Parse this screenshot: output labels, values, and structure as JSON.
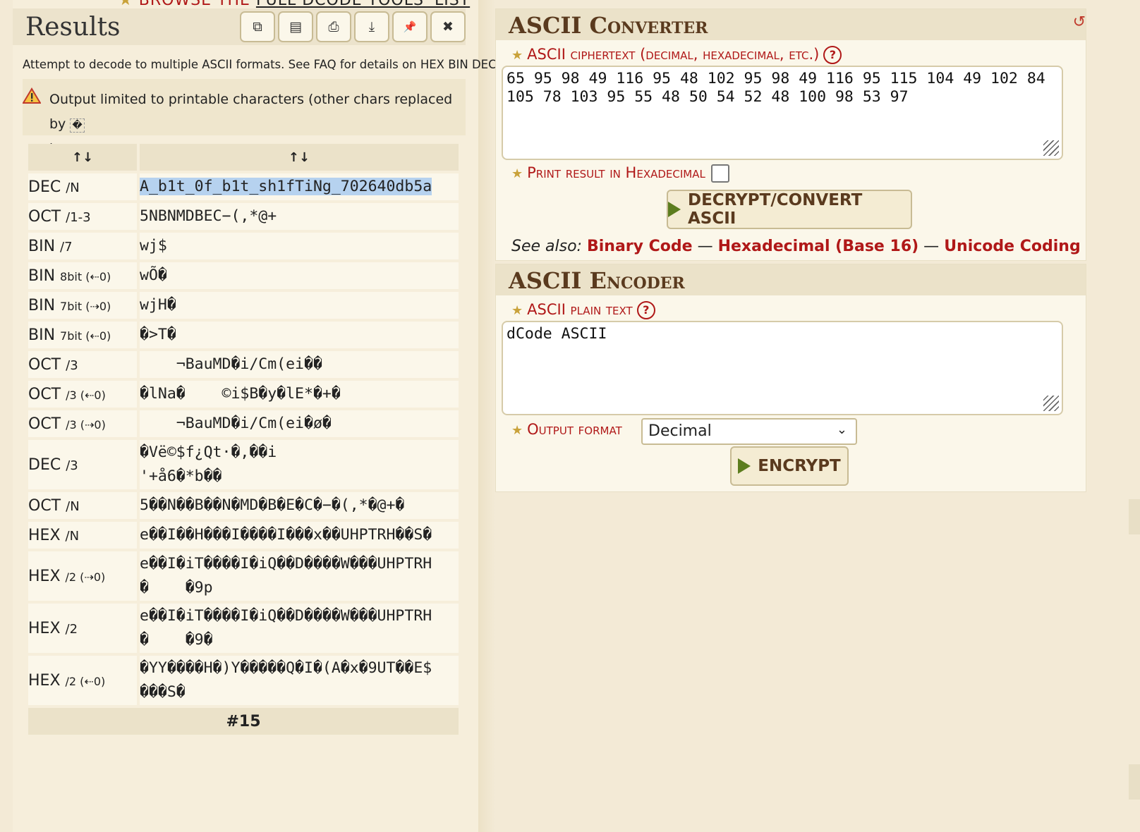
{
  "browse_link": {
    "star": "★",
    "prefix": "BROWSE THE",
    "link": "FULL DCODE TOOLS' LIST"
  },
  "results": {
    "title": "Results",
    "toolbar": [
      {
        "name": "copy-icon",
        "glyph": "⧉"
      },
      {
        "name": "save-icon",
        "glyph": "▤"
      },
      {
        "name": "print-icon",
        "glyph": "⎙"
      },
      {
        "name": "download-icon",
        "glyph": "⤓"
      },
      {
        "name": "pin-icon",
        "glyph": "📌"
      },
      {
        "name": "close-icon",
        "glyph": "✖"
      }
    ],
    "note": "Attempt to decode to multiple ASCII formats. See FAQ for details on HEX BIN DEC",
    "warning": "Output limited to printable characters (other chars replaced by",
    "warning_glyph": "�",
    "warning_close": ")",
    "sort_left": "↑↓",
    "sort_right": "↑↓",
    "rows": [
      {
        "label": "DEC",
        "sub": "/N",
        "value": "A_b1t_0f_b1t_sh1fTiNg_702640db5a"
      },
      {
        "label": "OCT",
        "sub": "/1-3",
        "value": "5NBNMDBEC−(,*@+"
      },
      {
        "label": "BIN",
        "sub": "/7",
        "value": "wj$"
      },
      {
        "label": "BIN",
        "sub": "8bit (⇠0)",
        "value": "wÕ�"
      },
      {
        "label": "BIN",
        "sub": "7bit (⇢0)",
        "value": "wjH�"
      },
      {
        "label": "BIN",
        "sub": "7bit (⇠0)",
        "value": "�>T�"
      },
      {
        "label": "OCT",
        "sub": "/3",
        "value": "    ¬BauMD�i/Cm(ei��"
      },
      {
        "label": "OCT",
        "sub": "/3 (⇠0)",
        "value": "�lNa�    ©i$B�y�lE*�+�"
      },
      {
        "label": "OCT",
        "sub": "/3 (⇢0)",
        "value": "    ¬BauMD�i/Cm(ei�ø�"
      },
      {
        "label": "DEC",
        "sub": "/3",
        "value": "�Vë©$f¿Qt·�,��i\n'+å6�*b��"
      },
      {
        "label": "OCT",
        "sub": "/N",
        "value": "5��N��B��N�MD�B�E�C�−�(,*�@+�"
      },
      {
        "label": "HEX",
        "sub": "/N",
        "value": "e��I��H���I����I���x��UHPTRH��S�"
      },
      {
        "label": "HEX",
        "sub": "/2 (⇢0)",
        "value": "e��I�iT����I�iQ��D����W���UHPTRH\n�    �9p"
      },
      {
        "label": "HEX",
        "sub": "/2",
        "value": "e��I�iT����I�iQ��D����W���UHPTRH\n�    �9�"
      },
      {
        "label": "HEX",
        "sub": "/2 (⇠0)",
        "value": "�YY����H�)Y�����Q�I�(A�x�9UT��E$\n���S�"
      }
    ],
    "footer": "#15"
  },
  "converter": {
    "title": "ASCII Converter",
    "refresh_glyph": "↺",
    "label": "ASCII ciphertext (decimal, hexadecimal, etc.)",
    "help": "?",
    "input_value": "65 95 98 49 116 95 48 102 95 98 49 116 95 115 104 49 102 84\n105 78 103 95 55 48 50 54 52 48 100 98 53 97",
    "hex_label": "Print result in Hexadecimal",
    "hex_checked": false,
    "button": "DECRYPT/CONVERT ASCII",
    "see_also_label": "See also:",
    "see_also": [
      "Binary Code",
      "Hexadecimal (Base 16)",
      "Unicode Coding"
    ],
    "sep": " — "
  },
  "encoder": {
    "title": "ASCII Encoder",
    "label": "ASCII plain text",
    "help": "?",
    "input_value": "dCode ASCII",
    "format_label": "Output format",
    "format_value": "Decimal",
    "button": "ENCRYPT"
  },
  "colors": {
    "accent": "#b01818",
    "title_brown": "#5a3a1e",
    "play_green": "#5c7d1e",
    "star_gold": "#c9a23a"
  }
}
